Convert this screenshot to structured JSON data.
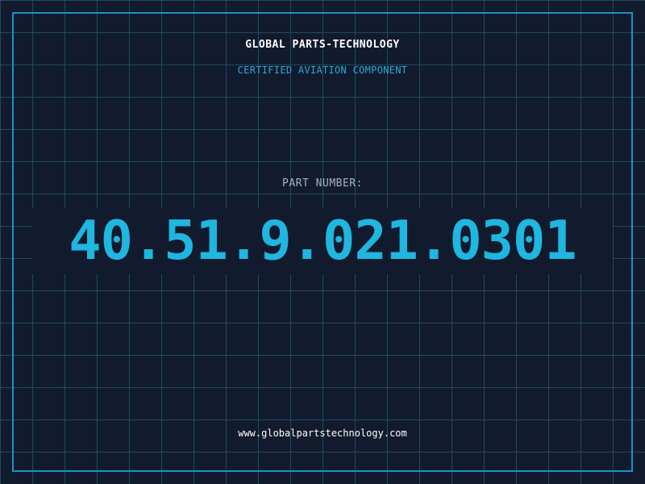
{
  "header": {
    "company": "GLOBAL PARTS-TECHNOLOGY",
    "tagline": "CERTIFIED AVIATION COMPONENT"
  },
  "part": {
    "label": "PART NUMBER:",
    "number": "40.51.9.021.0301"
  },
  "footer": {
    "website": "www.globalpartstechnology.com"
  },
  "colors": {
    "background": "#121a2d",
    "grid": "#1f4a62",
    "frame": "#1a93c2",
    "accent": "#1fb6e0",
    "muted": "#a7b3c4",
    "text": "#ffffff"
  }
}
